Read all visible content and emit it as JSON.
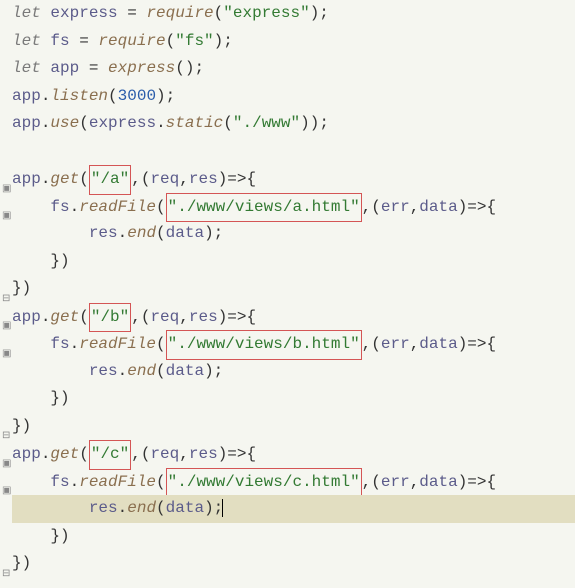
{
  "code": {
    "l1_let": "let",
    "l1_var": " express ",
    "l1_eq": "= ",
    "l1_func": "require",
    "l1_p1": "(",
    "l1_str": "\"express\"",
    "l1_p2": ");",
    "l2_let": "let",
    "l2_var": " fs ",
    "l2_eq": "= ",
    "l2_func": "require",
    "l2_p1": "(",
    "l2_str": "\"fs\"",
    "l2_p2": ");",
    "l3_let": "let",
    "l3_var": " app ",
    "l3_eq": "= ",
    "l3_func": "express",
    "l3_p2": "();",
    "l4_var": "app",
    "l4_dot": ".",
    "l4_func": "listen",
    "l4_p1": "(",
    "l4_num": "3000",
    "l4_p2": ");",
    "l5_var": "app",
    "l5_dot1": ".",
    "l5_func": "use",
    "l5_p1": "(",
    "l5_var2": "express",
    "l5_dot2": ".",
    "l5_func2": "static",
    "l5_p2": "(",
    "l5_str": "\"./www\"",
    "l5_p3": "));",
    "l7_var": "app",
    "l7_dot": ".",
    "l7_func": "get",
    "l7_p1": "(",
    "l7_str": "\"/a\"",
    "l7_comma": ",(",
    "l7_req": "req",
    "l7_comma2": ",",
    "l7_res": "res",
    "l7_arrow": ")=>{",
    "l8_indent": "    ",
    "l8_var": "fs",
    "l8_dot": ".",
    "l8_func": "readFile",
    "l8_p1": "(",
    "l8_str": "\"./www/views/a.html\"",
    "l8_comma": ",(",
    "l8_err": "err",
    "l8_comma2": ",",
    "l8_data": "data",
    "l8_arrow": ")=>{",
    "l9_indent": "        ",
    "l9_res": "res",
    "l9_dot": ".",
    "l9_func": "end",
    "l9_p1": "(",
    "l9_data": "data",
    "l9_p2": ");",
    "l10_indent": "    ",
    "l10_close": "})",
    "l11_close": "})",
    "l12_var": "app",
    "l12_dot": ".",
    "l12_func": "get",
    "l12_p1": "(",
    "l12_str": "\"/b\"",
    "l12_comma": ",(",
    "l12_req": "req",
    "l12_comma2": ",",
    "l12_res": "res",
    "l12_arrow": ")=>{",
    "l13_indent": "    ",
    "l13_var": "fs",
    "l13_dot": ".",
    "l13_func": "readFile",
    "l13_p1": "(",
    "l13_str": "\"./www/views/b.html\"",
    "l13_comma": ",(",
    "l13_err": "err",
    "l13_comma2": ",",
    "l13_data": "data",
    "l13_arrow": ")=>{",
    "l14_indent": "        ",
    "l14_res": "res",
    "l14_dot": ".",
    "l14_func": "end",
    "l14_p1": "(",
    "l14_data": "data",
    "l14_p2": ");",
    "l15_indent": "    ",
    "l15_close": "})",
    "l16_close": "})",
    "l17_var": "app",
    "l17_dot": ".",
    "l17_func": "get",
    "l17_p1": "(",
    "l17_str": "\"/c\"",
    "l17_comma": ",(",
    "l17_req": "req",
    "l17_comma2": ",",
    "l17_res": "res",
    "l17_arrow": ")=>{",
    "l18_indent": "    ",
    "l18_var": "fs",
    "l18_dot": ".",
    "l18_func": "readFile",
    "l18_p1": "(",
    "l18_str": "\"./www/views/c.html\"",
    "l18_comma": ",(",
    "l18_err": "err",
    "l18_comma2": ",",
    "l18_data": "data",
    "l18_arrow": ")=>{",
    "l19_indent": "        ",
    "l19_res": "res",
    "l19_dot": ".",
    "l19_func": "end",
    "l19_p1": "(",
    "l19_data": "data",
    "l19_p2": ");",
    "l20_indent": "    ",
    "l20_close": "})",
    "l21_close": "})"
  }
}
